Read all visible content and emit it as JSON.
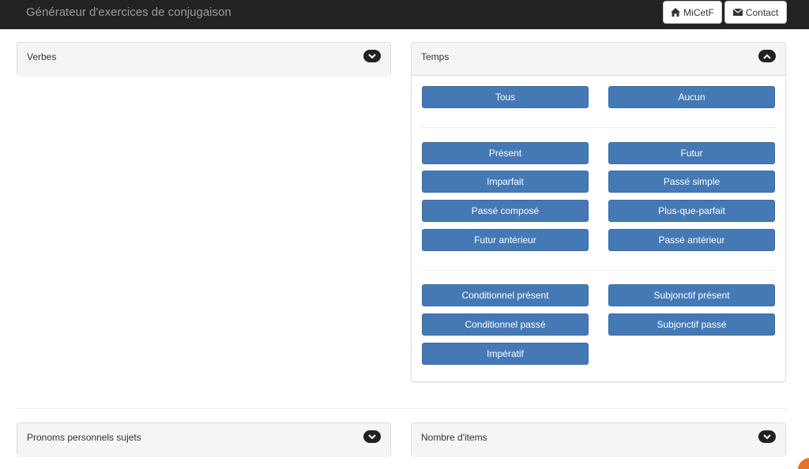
{
  "header": {
    "title": "Générateur d'exercices de conjugaison",
    "micetf_label": "MiCetF",
    "contact_label": "Contact"
  },
  "panels": {
    "verbes": {
      "title": "Verbes"
    },
    "temps": {
      "title": "Temps",
      "all_label": "Tous",
      "none_label": "Aucun",
      "group1": [
        "Présent",
        "Futur",
        "Imparfait",
        "Passé simple",
        "Passé composé",
        "Plus-que-parfait",
        "Futur antérieur",
        "Passé antérieur"
      ],
      "group2": [
        "Conditionnel présent",
        "Subjonctif présent",
        "Conditionnel passé",
        "Subjonctif passé",
        "Impératif"
      ]
    },
    "pronoms": {
      "title": "Pronoms personnels sujets"
    },
    "nombre": {
      "title": "Nombre d'items"
    }
  },
  "colors": {
    "navbar": "#222222",
    "button_primary": "#4479b5",
    "panel_heading": "#f5f5f5"
  },
  "icons": {
    "home": "home-icon",
    "mail": "envelope-icon",
    "expand": "chevron-down-icon",
    "collapse": "chevron-up-icon"
  }
}
